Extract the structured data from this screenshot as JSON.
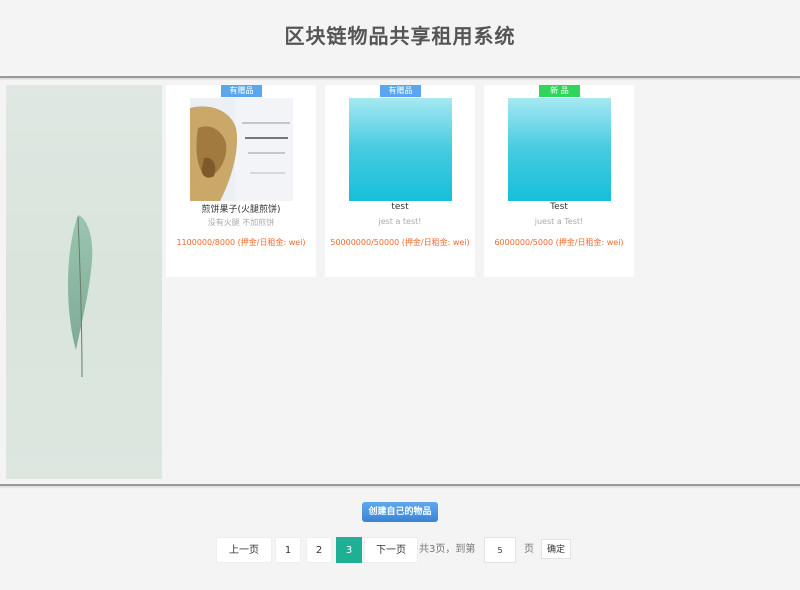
{
  "header": {
    "title": "区块链物品共享租用系统"
  },
  "colors": {
    "badge_blue": "#5aa7f0",
    "badge_green": "#2fd65a",
    "price": "#f0692c",
    "page_active": "#1eaf94"
  },
  "items": [
    {
      "badge": "有赠品",
      "name": "煎饼果子(火腿煎饼)",
      "desc": "没有火腿 不加煎饼",
      "price": "1100000/8000 (押金/日租金: wei)",
      "image": "pancake-photo"
    },
    {
      "badge": "有赠品",
      "name": "test",
      "desc": "jest a test!",
      "price": "50000000/50000 (押金/日租金: wei)",
      "image": "blue-sky-image"
    },
    {
      "badge": "新 品",
      "name": "Test",
      "desc": "juest a Test!",
      "price": "6000000/5000 (押金/日租金: wei)",
      "image": "blue-sky-image"
    }
  ],
  "create_button": "创建自己的物品",
  "pagination": {
    "prev": "上一页",
    "pages": [
      "1",
      "2",
      "3"
    ],
    "current": "3",
    "next": "下一页",
    "total_text": "共3页，到第",
    "input_value": "5",
    "page_suffix": "页",
    "confirm": "确定"
  }
}
